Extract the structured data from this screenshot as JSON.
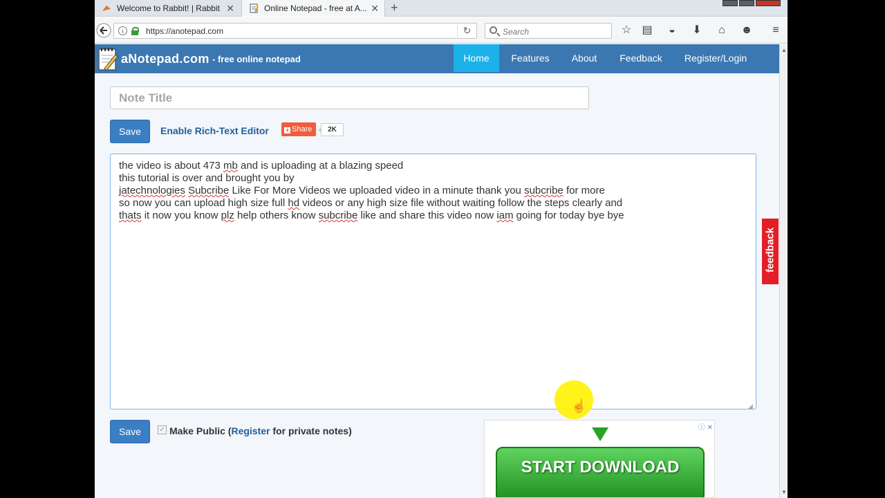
{
  "browser": {
    "tabs": [
      {
        "title": "Welcome to Rabbit! | Rabbit",
        "active": false
      },
      {
        "title": "Online Notepad - free at A...",
        "active": true
      }
    ],
    "url": "https://anotepad.com",
    "search_placeholder": "Search"
  },
  "site": {
    "logo": "aNotepad.com",
    "tagline": "- free online notepad",
    "nav": [
      "Home",
      "Features",
      "About",
      "Feedback",
      "Register/Login"
    ],
    "active_nav": "Home"
  },
  "editor": {
    "title_placeholder": "Note Title",
    "save_label": "Save",
    "rich_text_link": "Enable Rich-Text Editor",
    "share_label": "Share",
    "share_count": "2K",
    "lines": [
      "the video is about 473 mb and is uploading at a blazing speed",
      "this tutorial is over and brought you by",
      "jatechnologies Subcribe Like For More Videos we uploaded video in a minute thank you subcribe for more",
      "so now you can upload high size full hd videos or any high size file without waiting follow the steps clearly and",
      "thats it now you know plz help others know subcribe like and share this video now iam going for today bye bye"
    ],
    "public_prefix": "Make Public (",
    "public_link": "Register",
    "public_suffix": " for private notes)",
    "public_checked": true
  },
  "ad": {
    "button": "START DOWNLOAD"
  },
  "feedback_tab": "feedback",
  "colors": {
    "header": "#3b78b1",
    "nav_active": "#1cb1e8",
    "save_button": "#3a7ec3",
    "share_button": "#f05c3c",
    "feedback_tab": "#e41e26",
    "ad_button": "#27a327"
  }
}
